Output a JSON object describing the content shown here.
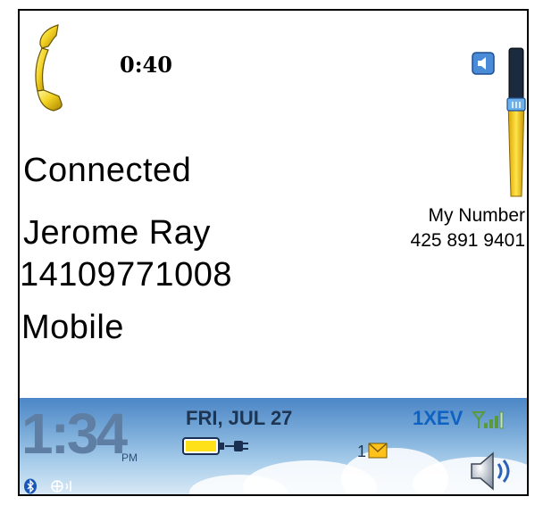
{
  "call": {
    "timer": "0:40",
    "status": "Connected",
    "contact_name": "Jerome Ray",
    "contact_number": "14109771008",
    "number_type": "Mobile"
  },
  "my_number": {
    "label": "My Number",
    "value": "425 891 9401"
  },
  "volume": {
    "icon": "speaker-icon",
    "level": 0.78
  },
  "statusbar": {
    "time": "1:34",
    "ampm": "PM",
    "date": "FRI, JUL 27",
    "network": "1XEV",
    "message_count": "1",
    "icons": [
      "bluetooth-icon",
      "signal-icon",
      "battery-icon",
      "charging-plug-icon",
      "envelope-icon",
      "speaker-volume-icon",
      "globe-signal-icon"
    ],
    "battery_level": 1.0
  }
}
